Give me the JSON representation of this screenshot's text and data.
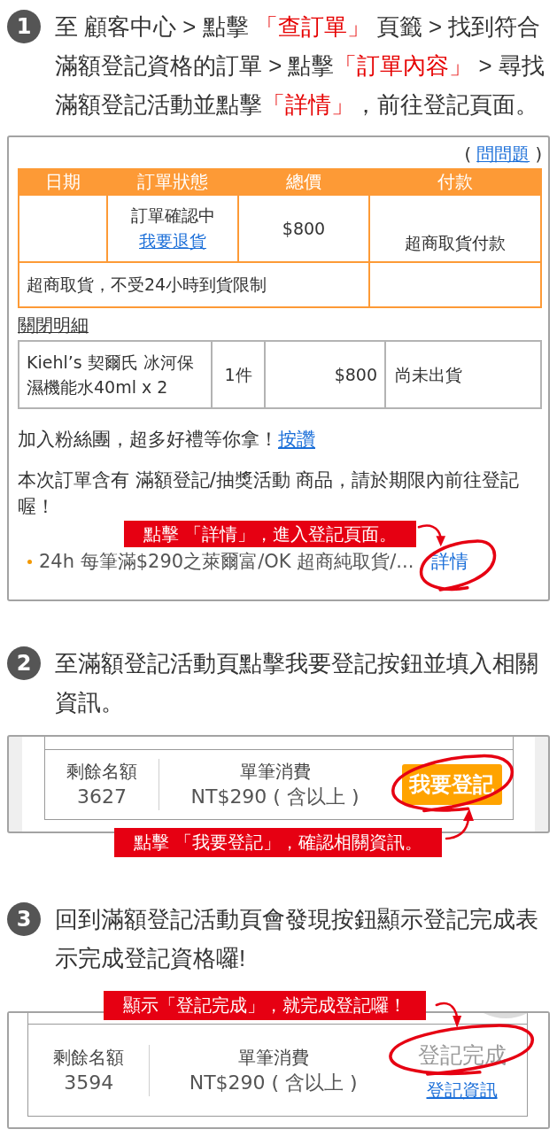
{
  "steps": [
    {
      "number": "1",
      "instruction": [
        {
          "text": "至 顧客中心 > 點擊 ",
          "highlight": false
        },
        {
          "text": "「查訂單」",
          "highlight": true
        },
        {
          "text": " 頁籤 > 找到符合滿額登記資格的訂單 > 點擊",
          "highlight": false
        },
        {
          "text": "「訂單內容」",
          "highlight": true
        },
        {
          "text": " > 尋找滿額登記活動並點擊",
          "highlight": false
        },
        {
          "text": "「詳情」",
          "highlight": true
        },
        {
          "text": "，前往登記頁面。",
          "highlight": false
        }
      ],
      "panel": {
        "kind": "order",
        "help": {
          "prefix": "(",
          "link": "問問題",
          "suffix": ")"
        },
        "summary": {
          "columns": [
            "日期",
            "訂單狀態",
            "總價",
            "付款"
          ],
          "rows": [
            {
              "status": "訂單確認中",
              "return_link": "我要退貨",
              "total": "$800",
              "payment": "超商取貨付款",
              "note": "超商取貨，不受24小時到貨限制"
            }
          ]
        },
        "details_toggle": "關閉明細",
        "items": [
          {
            "name": "Kiehl’s 契爾氏 冰河保濕機能水40ml x 2",
            "quantity": "1件",
            "price": "$800",
            "status": "尚未出貨"
          }
        ],
        "fan_message": {
          "text": "加入粉絲團，超多好禮等你拿！",
          "link": "按讚"
        },
        "event_notice": "本次訂單含有 滿額登記/抽獎活動 商品，請於期限內前往登記喔！",
        "callout": "點擊 「詳情」，進入登記頁面。",
        "events": [
          {
            "title": "24h 每筆滿$290之萊爾富/OK 超商純取貨/...",
            "link": "詳情"
          }
        ]
      }
    },
    {
      "number": "2",
      "instruction": [
        {
          "text": "至滿額登記活動頁點擊我要登記按鈕並填入相關資訊。",
          "highlight": false
        }
      ],
      "panel": {
        "kind": "event",
        "quota_label": "剩餘名額",
        "quota": "3627",
        "spend_label": "單筆消費",
        "spend": "NT$290 ( 含以上 )",
        "action": {
          "kind": "button",
          "label": "我要登記"
        },
        "callout": "點擊 「我要登記」，確認相關資訊。"
      }
    },
    {
      "number": "3",
      "instruction": [
        {
          "text": "回到滿額登記活動頁會發現按鈕顯示登記完成表示完成登記資格囉!",
          "highlight": false
        }
      ],
      "panel": {
        "kind": "event",
        "quota_label": "剩餘名額",
        "quota": "3594",
        "spend_label": "單筆消費",
        "spend": "NT$290 ( 含以上 )",
        "action": {
          "kind": "done",
          "label": "登記完成",
          "link": "登記資訊"
        },
        "callout": "顯示「登記完成」，就完成登記囉！"
      }
    }
  ]
}
